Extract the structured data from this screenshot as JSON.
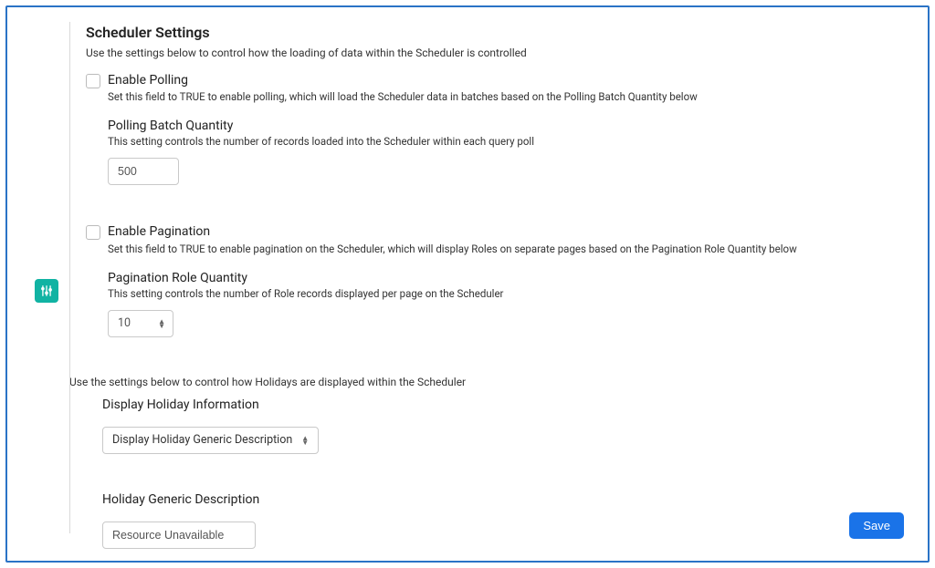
{
  "page": {
    "title": "Scheduler Settings",
    "intro_data": "Use the settings below to control how the loading of data within the Scheduler is controlled",
    "intro_holiday": "Use the settings below to control how Holidays are displayed within the Scheduler"
  },
  "polling": {
    "enable_label": "Enable Polling",
    "enable_desc": "Set this field to TRUE to enable polling, which will load the Scheduler data in batches based on the Polling Batch Quantity below",
    "batch_label": "Polling Batch Quantity",
    "batch_desc": "This setting controls the number of records loaded into the Scheduler within each query poll",
    "batch_value": "500"
  },
  "pagination": {
    "enable_label": "Enable Pagination",
    "enable_desc": "Set this field to TRUE to enable pagination on the Scheduler, which will display Roles on separate pages based on the Pagination Role Quantity below",
    "role_label": "Pagination Role Quantity",
    "role_desc": "This setting controls the number of Role records displayed per page on the Scheduler",
    "role_value": "10"
  },
  "holiday": {
    "display_label": "Display Holiday Information",
    "display_value": "Display Holiday Generic Description",
    "generic_label": "Holiday Generic Description",
    "generic_value": "Resource Unavailable"
  },
  "buttons": {
    "save": "Save"
  }
}
